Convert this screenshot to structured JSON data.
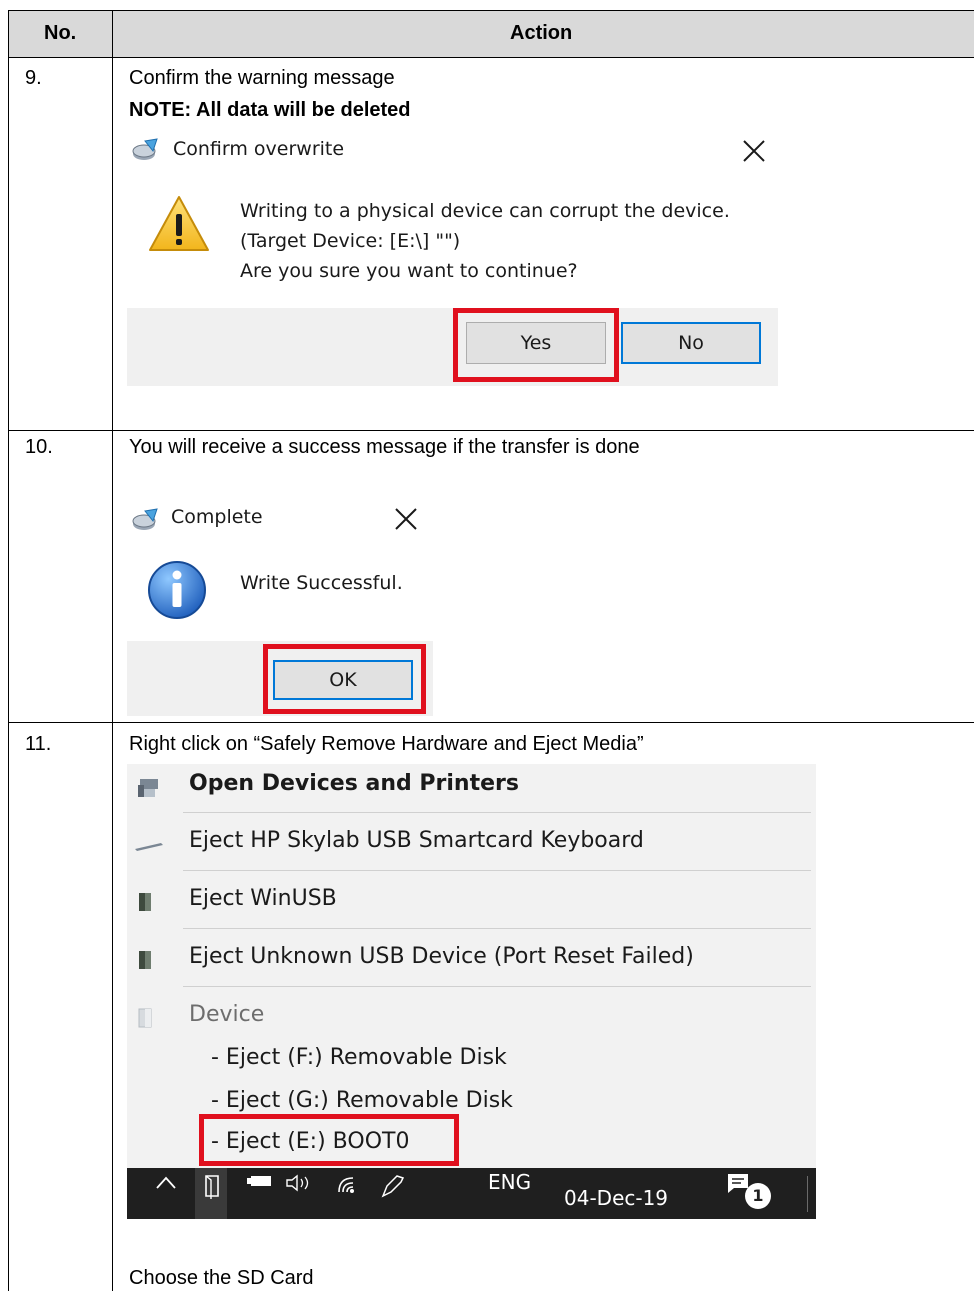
{
  "table": {
    "header": {
      "no": "No.",
      "action": "Action"
    },
    "rows": [
      {
        "no": "9.",
        "line1": "Confirm the warning message",
        "note": "NOTE: All data will be deleted",
        "dialog": {
          "title": "Confirm overwrite",
          "message": [
            "Writing to a physical device can corrupt the device.",
            "(Target Device: [E:\\] \"\")",
            "Are you sure you want to continue?"
          ],
          "yes": "Yes",
          "no": "No"
        }
      },
      {
        "no": "10.",
        "line1": "You will receive a success message if the transfer is done",
        "dialog": {
          "title": "Complete",
          "message": "Write Successful.",
          "ok": "OK"
        }
      },
      {
        "no": "11.",
        "line1": "Right click on “Safely Remove Hardware and Eject Media”",
        "menu": {
          "items": [
            "Open Devices and Printers",
            "Eject HP Skylab USB Smartcard Keyboard",
            "Eject WinUSB",
            "Eject Unknown USB Device (Port Reset Failed)",
            "Device"
          ],
          "sub_items": [
            "-  Eject (F:) Removable Disk",
            "-  Eject (G:) Removable Disk",
            "-  Eject (E:) BOOT0"
          ]
        },
        "taskbar": {
          "lang": "ENG",
          "date": "04-Dec-19",
          "badge": "1"
        },
        "line2": "Choose the SD Card"
      }
    ]
  },
  "colors": {
    "highlight": "#e0101e",
    "focus": "#0078d7",
    "header_bg": "#d9d9d9"
  }
}
